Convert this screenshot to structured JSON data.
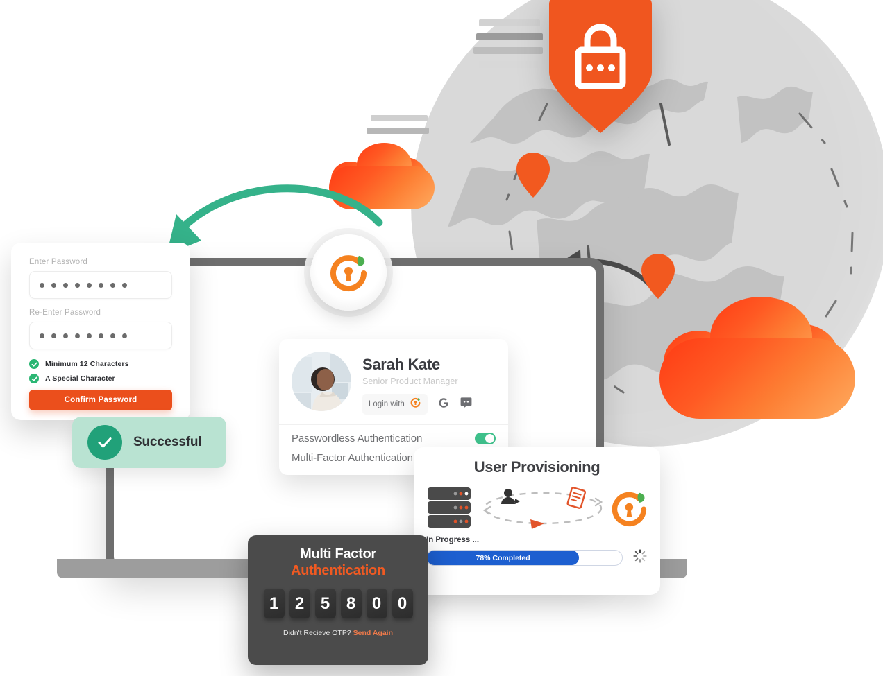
{
  "colors": {
    "brand_orange": "#eb4f1c",
    "cloud_orange_start": "#ff3b14",
    "cloud_orange_end": "#ffab5f",
    "success_green": "#21a179",
    "toast_bg": "#b9e3d2",
    "toggle_green": "#3fc18c",
    "progress_blue": "#1d5fd0",
    "globe_grey": "#d9d9d9",
    "laptop_bezel": "#6e6e6e",
    "otp_card_bg": "#4b4b4b",
    "otp_accent": "#f05a22"
  },
  "password_card": {
    "enter_label": "Enter Password",
    "enter_value": "••••••••",
    "enter_dots": 8,
    "reenter_label": "Re-Enter Password",
    "reenter_value": "••••••••",
    "reenter_dots": 8,
    "requirements": [
      {
        "label": "Minimum 12 Characters",
        "met": true
      },
      {
        "label": "A Special Character",
        "met": true
      }
    ],
    "confirm_button": "Confirm Password"
  },
  "toast": {
    "label": "Successful",
    "icon": "check-icon"
  },
  "profile_card": {
    "name": "Sarah Kate",
    "role": "Senior Product Manager",
    "login_with_label": "Login with",
    "login_providers": [
      "cloudlock-icon",
      "google-icon",
      "discord-icon"
    ],
    "settings": [
      {
        "label": "Passwordless Authentication",
        "enabled": true
      },
      {
        "label": "Multi-Factor Authentication",
        "enabled": true
      }
    ]
  },
  "user_provisioning": {
    "title": "User Provisioning",
    "status": "In Progress ...",
    "progress_label": "78% Completed",
    "progress_percent": 78,
    "diagram_icons": [
      "server-stack-icon",
      "add-user-icon",
      "document-icon",
      "keyhole-ring-icon",
      "play-arrow-icon"
    ]
  },
  "otp_card": {
    "title_line1": "Multi Factor",
    "title_line2": "Authentication",
    "digits": [
      "1",
      "2",
      "5",
      "8",
      "0",
      "0"
    ],
    "footer_question": "Didn't Recieve OTP? ",
    "footer_action": "Send Again"
  },
  "scene": {
    "shield_icon": "shield-lock-icon",
    "badge_icon": "keyhole-ring-leaf-icon",
    "globe_pins": 2,
    "clouds": 2,
    "arrows": [
      "green-curved-arrow",
      "dark-curved-arrow"
    ]
  }
}
